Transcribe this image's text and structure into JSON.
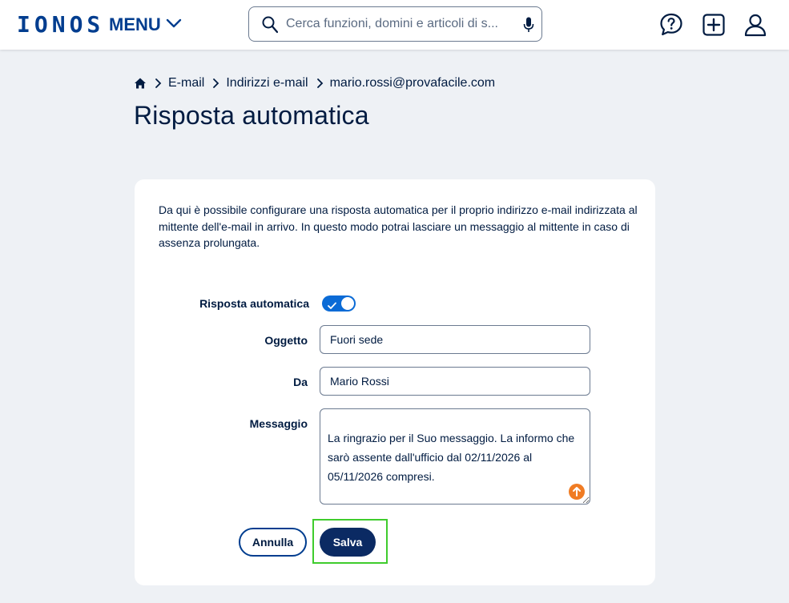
{
  "header": {
    "logo": "IONOS",
    "menu_label": "MENU",
    "search_placeholder": "Cerca funzioni, domini e articoli di s...",
    "icons": [
      "chevron-down-icon",
      "search-icon",
      "microphone-icon",
      "help-icon",
      "add-icon",
      "user-icon"
    ]
  },
  "breadcrumb": {
    "items": [
      "E-mail",
      "Indirizzi e-mail",
      "mario.rossi@provafacile.com"
    ]
  },
  "page": {
    "title": "Risposta automatica"
  },
  "card": {
    "intro": "Da qui è possibile configurare una risposta automatica per il proprio indirizzo e-mail indirizzata al mittente dell'e-mail in arrivo. In questo modo potrai lasciare un messaggio al mittente in caso di assenza prolungata.",
    "toggle": {
      "label": "Risposta automatica",
      "enabled": true
    },
    "subject": {
      "label": "Oggetto",
      "value": "Fuori sede"
    },
    "from": {
      "label": "Da",
      "value": "Mario Rossi"
    },
    "message": {
      "label": "Messaggio",
      "value": "La ringrazio per il Suo messaggio. La informo che sarò assente dall'ufficio dal 02/11/2026 al 05/11/2026 compresi."
    },
    "cancel_label": "Annulla",
    "save_label": "Salva"
  },
  "colors": {
    "brand": "#003d8f",
    "text": "#001b41",
    "toggle_on": "#0b6bd6",
    "save_bg": "#0b2a63",
    "highlight": "#3fcc2d",
    "badge": "#f07c24"
  }
}
